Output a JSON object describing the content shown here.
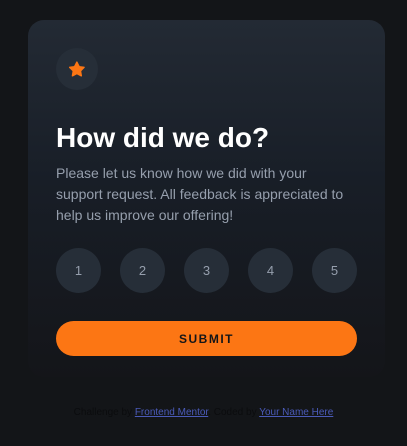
{
  "card": {
    "icon": "star-icon",
    "title": "How did we do?",
    "description": "Please let us know how we did with your support request. All feedback is appreciated to help us improve our offering!",
    "ratings": [
      "1",
      "2",
      "3",
      "4",
      "5"
    ],
    "submit_label": "SUBMIT"
  },
  "attribution": {
    "prefix": "Challenge by",
    "link1": "Frontend Mentor",
    "middle": ". Coded by",
    "link2": "Your Name Here"
  },
  "colors": {
    "accent": "#fc7614",
    "background": "#131518",
    "card": "#1e252f",
    "muted_text": "#969fad",
    "rating_bg": "#262e38"
  }
}
